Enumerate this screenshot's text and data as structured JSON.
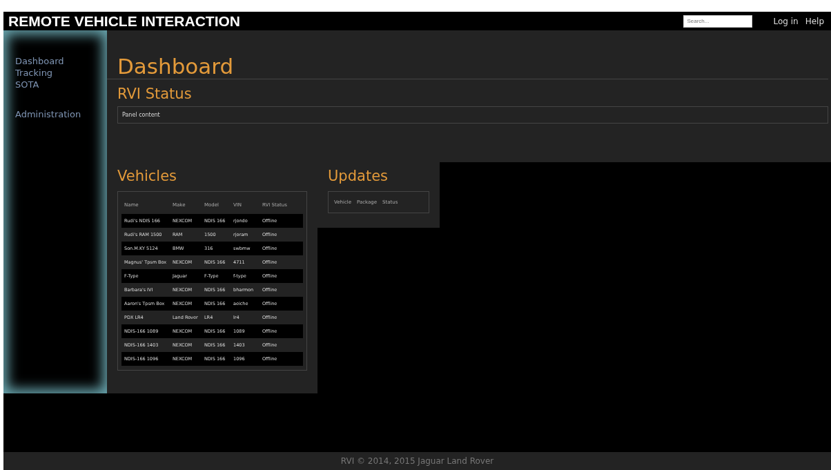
{
  "header": {
    "title": "REMOTE VEHICLE INTERACTION",
    "search": {
      "placeholder": "Search..."
    },
    "links": [
      "Log in",
      "Help"
    ]
  },
  "sidebar": {
    "groups": [
      [
        "Dashboard",
        "Tracking",
        "SOTA"
      ],
      [
        "Administration"
      ]
    ]
  },
  "page_title": "Dashboard",
  "rvi_status": {
    "title": "RVI Status",
    "panel": "Panel content"
  },
  "vehicles": {
    "title": "Vehicles",
    "columns": [
      "Name",
      "Make",
      "Model",
      "VIN",
      "RVI Status"
    ],
    "rows": [
      [
        "Rudi's NDIS 166",
        "NEXCOM",
        "NDIS 166",
        "rjondo",
        "Offline"
      ],
      [
        "Rudi's RAM 1500",
        "RAM",
        "1500",
        "rjoram",
        "Offline"
      ],
      [
        "Son.M.KY 5124",
        "BMW",
        "316",
        "swbmw",
        "Offline"
      ],
      [
        "Magnus' Tpsm Box",
        "NEXCOM",
        "NDIS 166",
        "4711",
        "Offline"
      ],
      [
        "F-Type",
        "Jaguar",
        "F-Type",
        "f-type",
        "Offline"
      ],
      [
        "Barbara's IVI",
        "NEXCOM",
        "NDIS 166",
        "bharmon",
        "Offline"
      ],
      [
        "Aaron's Tpsm Box",
        "NEXCOM",
        "NDIS 166",
        "aeiche",
        "Offline"
      ],
      [
        "PDX LR4",
        "Land Rover",
        "LR4",
        "lr4",
        "Offline"
      ],
      [
        "NDIS-166 1089",
        "NEXCOM",
        "NDIS 166",
        "1089",
        "Offline"
      ],
      [
        "NDIS-166 1403",
        "NEXCOM",
        "NDIS 166",
        "1403",
        "Offline"
      ],
      [
        "NDIS-166 1096",
        "NEXCOM",
        "NDIS 166",
        "1096",
        "Offline"
      ]
    ]
  },
  "updates": {
    "title": "Updates",
    "columns": [
      "Vehicle",
      "Package",
      "Status"
    ]
  },
  "footer": "RVI © 2014, 2015 Jaguar Land Rover"
}
